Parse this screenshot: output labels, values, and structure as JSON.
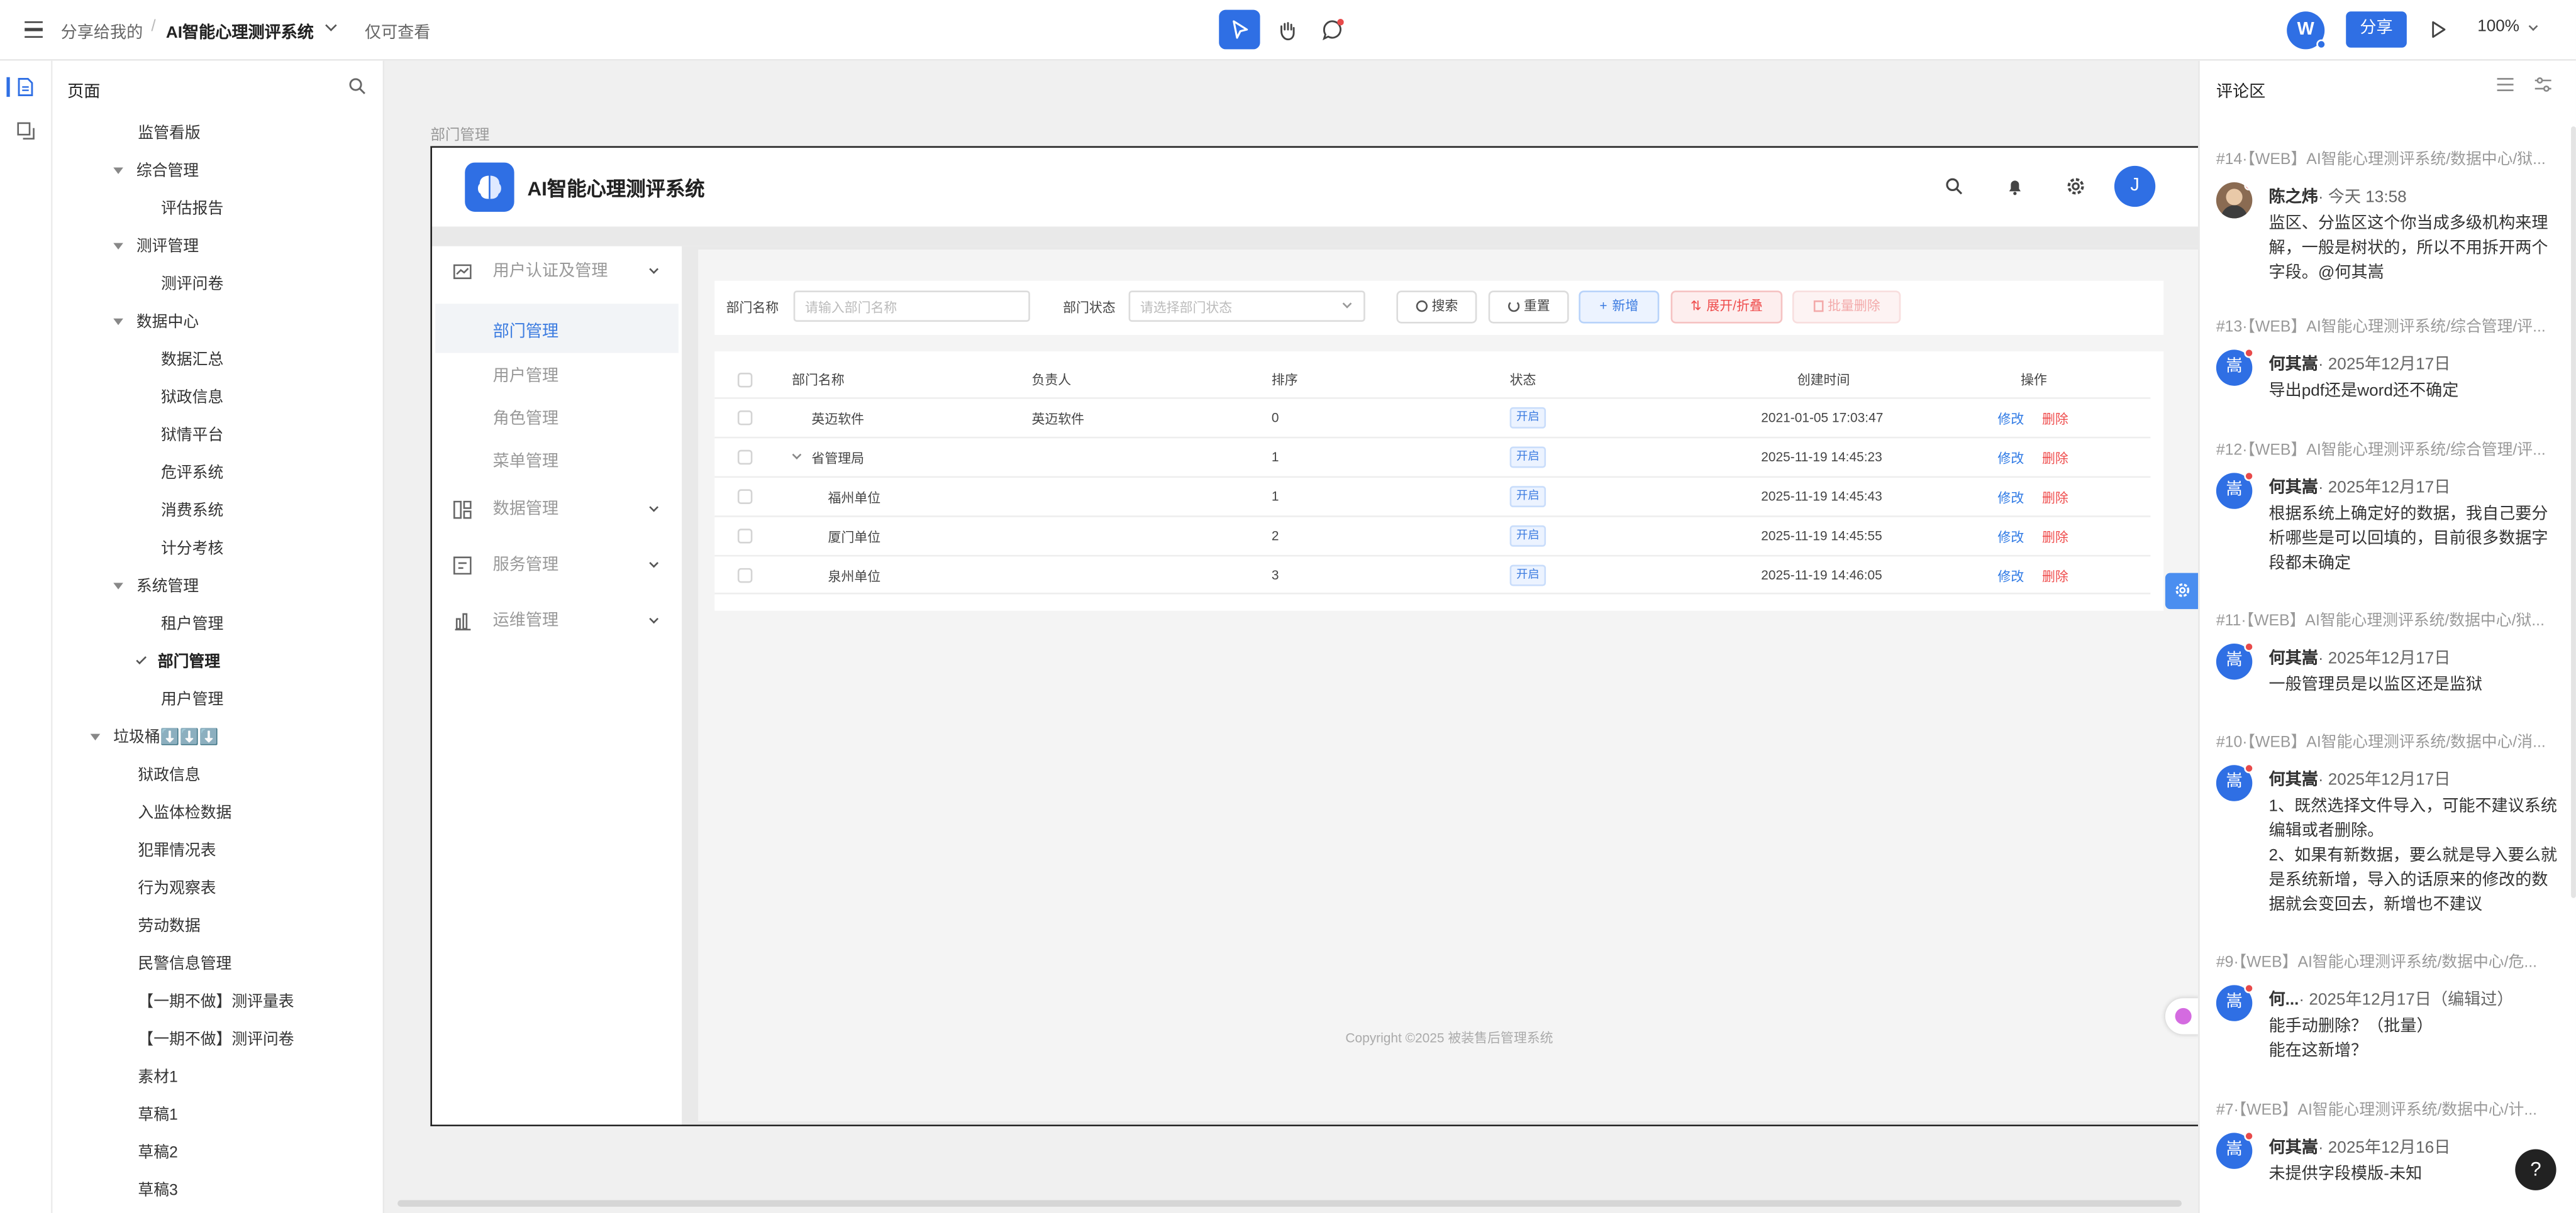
{
  "topbar": {
    "shared_label": "分享给我的",
    "separator": "/",
    "project_title": "AI智能心理测评系统",
    "readonly_label": "仅可查看",
    "user_initial": "W",
    "share_button": "分享",
    "zoom": "100%"
  },
  "tree": {
    "header": "页面",
    "items": [
      {
        "label": "监管看版"
      },
      {
        "label": "综合管理"
      },
      {
        "label": "评估报告"
      },
      {
        "label": "测评管理"
      },
      {
        "label": "测评问卷"
      },
      {
        "label": "数据中心"
      },
      {
        "label": "数据汇总"
      },
      {
        "label": "狱政信息"
      },
      {
        "label": "狱情平台"
      },
      {
        "label": "危评系统"
      },
      {
        "label": "消费系统"
      },
      {
        "label": "计分考核"
      },
      {
        "label": "系统管理"
      },
      {
        "label": "租户管理"
      },
      {
        "label": "部门管理"
      },
      {
        "label": "用户管理"
      },
      {
        "label": "垃圾桶⬇️⬇️⬇️"
      },
      {
        "label": "狱政信息"
      },
      {
        "label": "入监体检数据"
      },
      {
        "label": "犯罪情况表"
      },
      {
        "label": "行为观察表"
      },
      {
        "label": "劳动数据"
      },
      {
        "label": "民警信息管理"
      },
      {
        "label": "【一期不做】测评量表"
      },
      {
        "label": "【一期不做】测评问卷"
      },
      {
        "label": "素材1"
      },
      {
        "label": "草稿1"
      },
      {
        "label": "草稿2"
      },
      {
        "label": "草稿3"
      }
    ]
  },
  "canvas": {
    "frame_label": "部门管理"
  },
  "app": {
    "title": "AI智能心理测评系统",
    "user_initial": "J",
    "nav": {
      "group1": "用户认证及管理",
      "sub": [
        "部门管理",
        "用户管理",
        "角色管理",
        "菜单管理"
      ],
      "group2": "数据管理",
      "group3": "服务管理",
      "group4": "运维管理"
    },
    "filters": {
      "name_label": "部门名称",
      "name_placeholder": "请输入部门名称",
      "status_label": "部门状态",
      "status_placeholder": "请选择部门状态",
      "search": "搜索",
      "reset": "重置",
      "add": "新增",
      "expand": "展开/折叠",
      "batch_delete": "批量删除"
    },
    "table": {
      "headers": [
        "部门名称",
        "负责人",
        "排序",
        "状态",
        "创建时间",
        "操作"
      ],
      "rows": [
        {
          "name": "英迈软件",
          "leader": "英迈软件",
          "order": "0",
          "status": "开启",
          "created": "2021-01-05 17:03:47",
          "edit": "修改",
          "delete": "删除"
        },
        {
          "name": "省管理局",
          "leader": "",
          "order": "1",
          "status": "开启",
          "created": "2025-11-19 14:45:23",
          "edit": "修改",
          "delete": "删除"
        },
        {
          "name": "福州单位",
          "leader": "",
          "order": "1",
          "status": "开启",
          "created": "2025-11-19 14:45:43",
          "edit": "修改",
          "delete": "删除"
        },
        {
          "name": "厦门单位",
          "leader": "",
          "order": "2",
          "status": "开启",
          "created": "2025-11-19 14:45:55",
          "edit": "修改",
          "delete": "删除"
        },
        {
          "name": "泉州单位",
          "leader": "",
          "order": "3",
          "status": "开启",
          "created": "2025-11-19 14:46:05",
          "edit": "修改",
          "delete": "删除"
        }
      ]
    },
    "footer": "Copyright ©2025 被装售后管理系统"
  },
  "comments": {
    "title": "评论区",
    "items": [
      {
        "context": "#14·【WEB】AI智能心理测评系统/数据中心/狱...",
        "avatar": "",
        "author": "陈之炜",
        "time": "· 今天 13:58",
        "body": "监区、分监区这个你当成多级机构来理解，一般是树状的，所以不用拆开两个字段。@何其嵩"
      },
      {
        "context": "#13·【WEB】AI智能心理测评系统/综合管理/评...",
        "avatar": "嵩",
        "author": "何其嵩",
        "time": "· 2025年12月17日",
        "body": "导出pdf还是word还不确定"
      },
      {
        "context": "#12·【WEB】AI智能心理测评系统/综合管理/评...",
        "avatar": "嵩",
        "author": "何其嵩",
        "time": "· 2025年12月17日",
        "body": "根据系统上确定好的数据，我自己要分析哪些是可以回填的，目前很多数据字段都未确定"
      },
      {
        "context": "#11·【WEB】AI智能心理测评系统/数据中心/狱...",
        "avatar": "嵩",
        "author": "何其嵩",
        "time": "· 2025年12月17日",
        "body": "一般管理员是以监区还是监狱"
      },
      {
        "context": "#10·【WEB】AI智能心理测评系统/数据中心/消...",
        "avatar": "嵩",
        "author": "何其嵩",
        "time": "· 2025年12月17日",
        "body": "1、既然选择文件导入，可能不建议系统编辑或者删除。\n2、如果有新数据，要么就是导入要么就是系统新增，导入的话原来的修改的数据就会变回去，新增也不建议"
      },
      {
        "context": "#9·【WEB】AI智能心理测评系统/数据中心/危...",
        "avatar": "嵩",
        "author": "何...",
        "time": "· 2025年12月17日（编辑过）",
        "body": "能手动删除？（批量）\n能在这新增？"
      },
      {
        "context": "#7·【WEB】AI智能心理测评系统/数据中心/计...",
        "avatar": "嵩",
        "author": "何其嵩",
        "time": "· 2025年12月16日",
        "body": "未提供字段模版-未知"
      }
    ]
  },
  "help": "?"
}
